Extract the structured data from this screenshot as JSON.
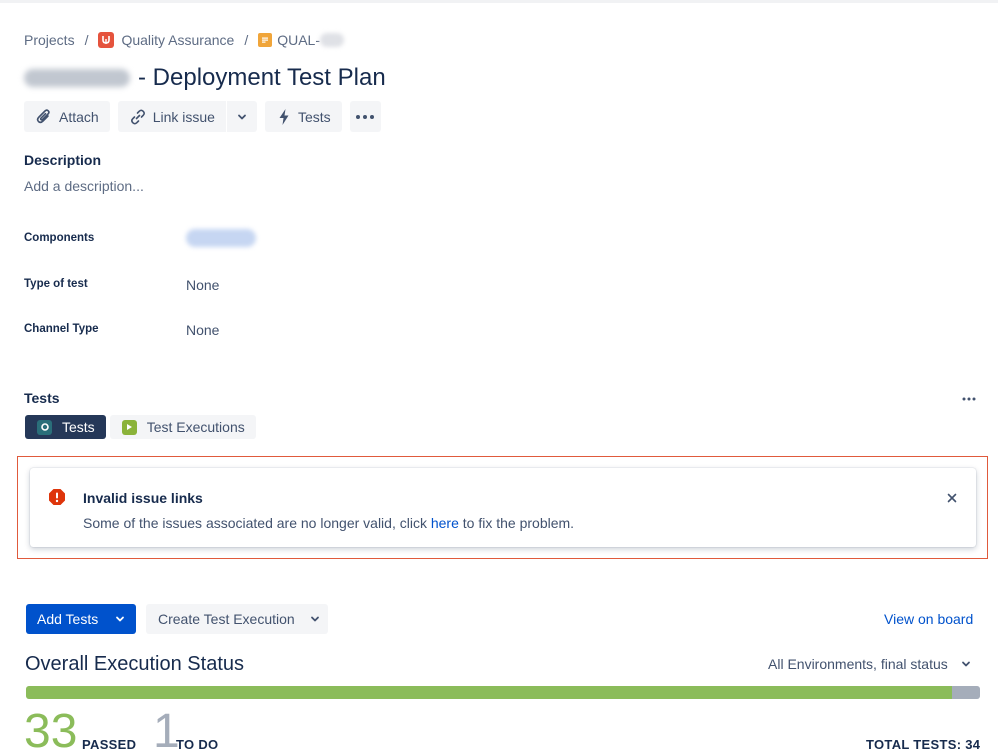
{
  "breadcrumb": {
    "projects": "Projects",
    "separator": "/",
    "project_name": "Quality Assurance",
    "issue_key": "QUAL-"
  },
  "issue": {
    "title": "- Deployment Test Plan"
  },
  "toolbar": {
    "attach": "Attach",
    "link_issue": "Link issue",
    "tests": "Tests"
  },
  "description": {
    "heading": "Description",
    "placeholder": "Add a description..."
  },
  "fields": {
    "components_label": "Components",
    "type_of_test_label": "Type of test",
    "type_of_test_value": "None",
    "channel_type_label": "Channel Type",
    "channel_type_value": "None"
  },
  "tests_panel": {
    "heading": "Tests",
    "tab_tests": "Tests",
    "tab_executions": "Test Executions"
  },
  "flag": {
    "title": "Invalid issue links",
    "body_before": "Some of the issues associated are no longer valid, click ",
    "link": "here",
    "body_after": " to fix the problem."
  },
  "actions": {
    "add_tests": "Add Tests",
    "create_execution": "Create Test Execution",
    "view_on_board": "View on board"
  },
  "execution": {
    "heading": "Overall Execution Status",
    "environment": "All Environments, final status",
    "passed_count": "33",
    "passed_label": "PASSED",
    "todo_count": "1",
    "todo_label": "TO DO",
    "total_label": "TOTAL TESTS: 34",
    "passed_fraction": 0.9706
  },
  "colors": {
    "primary": "#0052cc",
    "passed": "#8bbc5a",
    "todo": "#a5adba",
    "error": "#de350b",
    "highlight_border": "#e05a3c"
  }
}
